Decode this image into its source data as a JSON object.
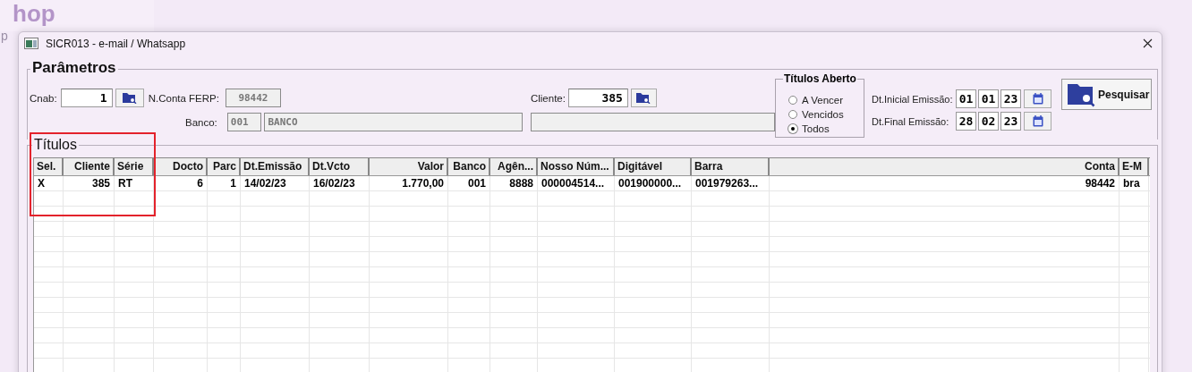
{
  "background": {
    "logo_text": "hop",
    "caption": "p"
  },
  "window": {
    "title": "SICR013 - e-mail / Whatsapp"
  },
  "parameters": {
    "title": "Parâmetros",
    "cnab": {
      "label": "Cnab:",
      "value": "1"
    },
    "account": {
      "label": "N.Conta FERP:",
      "value": "98442"
    },
    "client": {
      "label": "Cliente:",
      "value": "385"
    },
    "bank": {
      "label": "Banco:",
      "code": "001",
      "name": "BANCO"
    },
    "open_titles": {
      "title": "Títulos Aberto",
      "options": [
        {
          "label": "A Vencer",
          "selected": false
        },
        {
          "label": "Vencidos",
          "selected": false
        },
        {
          "label": "Todos",
          "selected": true
        }
      ]
    },
    "dates": [
      {
        "label": "Dt.Inicial Emissão:",
        "day": "01",
        "month": "01",
        "year": "23"
      },
      {
        "label": "Dt.Final Emissão:",
        "day": "28",
        "month": "02",
        "year": "23"
      }
    ],
    "search_button": "Pesquisar"
  },
  "titles": {
    "title": "Títulos",
    "columns": [
      "Sel.",
      "Cliente",
      "Série",
      "Docto",
      "Parc",
      "Dt.Emissão",
      "Dt.Vcto",
      "Valor",
      "Banco",
      "Agên...",
      "Nosso Núm...",
      "Digitável",
      "Barra",
      "Conta",
      "E-M"
    ],
    "rows": [
      [
        "X",
        "385",
        "RT",
        "6",
        "1",
        "14/02/23",
        "16/02/23",
        "1.770,00",
        "001",
        "8888",
        "000004514...",
        "001900000...",
        "001979263...",
        "98442",
        "bra"
      ]
    ]
  }
}
